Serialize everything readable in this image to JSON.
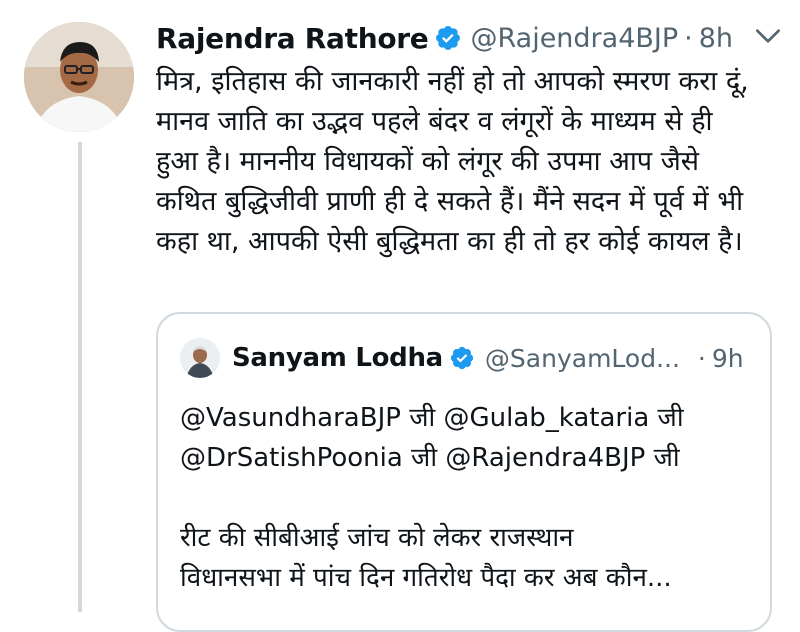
{
  "tweet": {
    "author_name": "Rajendra Rathore",
    "author_handle": "@Rajendra4BJP",
    "separator": "·",
    "time": "8h",
    "text": "मित्र, इतिहास की जानकारी नहीं हो तो आपको स्मरण करा दूं, मानव जाति का उद्भव पहले बंदर व लंगूरों के माध्यम से ही हुआ है। माननीय विधायकों को लंगूर की उपमा आप जैसे कथित बुद्धिजीवी प्राणी ही दे सकते हैं। मैंने सदन में पूर्व में भी कहा था, आपकी ऐसी बुद्धिमता का ही तो हर कोई कायल है।"
  },
  "quote": {
    "author_name": "Sanyam Lodha",
    "author_handle": "@SanyamLod...",
    "separator": "·",
    "time": "9h",
    "text": "@VasundharaBJP जी @Gulab_kataria जी\n@DrSatishPoonia जी @Rajendra4BJP जी\n\nरीट की सीबीआई जांच को लेकर राजस्थान\nविधानसभा में पांच दिन गतिरोध पैदा कर अब कौन..."
  },
  "colors": {
    "verified": "#1d9bf0",
    "secondary_text": "#536471",
    "border": "#cfd9de"
  },
  "icons": {
    "verified": "verified-badge-icon",
    "more": "chevron-down-icon"
  }
}
